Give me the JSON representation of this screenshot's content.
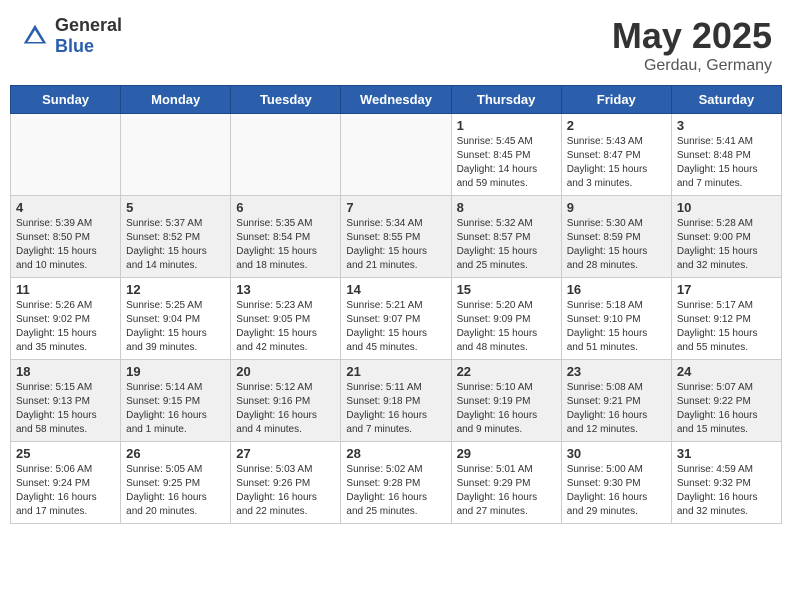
{
  "header": {
    "logo": {
      "general": "General",
      "blue": "Blue"
    },
    "title": "May 2025",
    "location": "Gerdau, Germany"
  },
  "calendar": {
    "days_of_week": [
      "Sunday",
      "Monday",
      "Tuesday",
      "Wednesday",
      "Thursday",
      "Friday",
      "Saturday"
    ],
    "weeks": [
      [
        {
          "day": "",
          "empty": true
        },
        {
          "day": "",
          "empty": true
        },
        {
          "day": "",
          "empty": true
        },
        {
          "day": "",
          "empty": true
        },
        {
          "day": "1",
          "lines": [
            "Sunrise: 5:45 AM",
            "Sunset: 8:45 PM",
            "Daylight: 14 hours",
            "and 59 minutes."
          ]
        },
        {
          "day": "2",
          "lines": [
            "Sunrise: 5:43 AM",
            "Sunset: 8:47 PM",
            "Daylight: 15 hours",
            "and 3 minutes."
          ]
        },
        {
          "day": "3",
          "lines": [
            "Sunrise: 5:41 AM",
            "Sunset: 8:48 PM",
            "Daylight: 15 hours",
            "and 7 minutes."
          ]
        }
      ],
      [
        {
          "day": "4",
          "lines": [
            "Sunrise: 5:39 AM",
            "Sunset: 8:50 PM",
            "Daylight: 15 hours",
            "and 10 minutes."
          ]
        },
        {
          "day": "5",
          "lines": [
            "Sunrise: 5:37 AM",
            "Sunset: 8:52 PM",
            "Daylight: 15 hours",
            "and 14 minutes."
          ]
        },
        {
          "day": "6",
          "lines": [
            "Sunrise: 5:35 AM",
            "Sunset: 8:54 PM",
            "Daylight: 15 hours",
            "and 18 minutes."
          ]
        },
        {
          "day": "7",
          "lines": [
            "Sunrise: 5:34 AM",
            "Sunset: 8:55 PM",
            "Daylight: 15 hours",
            "and 21 minutes."
          ]
        },
        {
          "day": "8",
          "lines": [
            "Sunrise: 5:32 AM",
            "Sunset: 8:57 PM",
            "Daylight: 15 hours",
            "and 25 minutes."
          ]
        },
        {
          "day": "9",
          "lines": [
            "Sunrise: 5:30 AM",
            "Sunset: 8:59 PM",
            "Daylight: 15 hours",
            "and 28 minutes."
          ]
        },
        {
          "day": "10",
          "lines": [
            "Sunrise: 5:28 AM",
            "Sunset: 9:00 PM",
            "Daylight: 15 hours",
            "and 32 minutes."
          ]
        }
      ],
      [
        {
          "day": "11",
          "lines": [
            "Sunrise: 5:26 AM",
            "Sunset: 9:02 PM",
            "Daylight: 15 hours",
            "and 35 minutes."
          ]
        },
        {
          "day": "12",
          "lines": [
            "Sunrise: 5:25 AM",
            "Sunset: 9:04 PM",
            "Daylight: 15 hours",
            "and 39 minutes."
          ]
        },
        {
          "day": "13",
          "lines": [
            "Sunrise: 5:23 AM",
            "Sunset: 9:05 PM",
            "Daylight: 15 hours",
            "and 42 minutes."
          ]
        },
        {
          "day": "14",
          "lines": [
            "Sunrise: 5:21 AM",
            "Sunset: 9:07 PM",
            "Daylight: 15 hours",
            "and 45 minutes."
          ]
        },
        {
          "day": "15",
          "lines": [
            "Sunrise: 5:20 AM",
            "Sunset: 9:09 PM",
            "Daylight: 15 hours",
            "and 48 minutes."
          ]
        },
        {
          "day": "16",
          "lines": [
            "Sunrise: 5:18 AM",
            "Sunset: 9:10 PM",
            "Daylight: 15 hours",
            "and 51 minutes."
          ]
        },
        {
          "day": "17",
          "lines": [
            "Sunrise: 5:17 AM",
            "Sunset: 9:12 PM",
            "Daylight: 15 hours",
            "and 55 minutes."
          ]
        }
      ],
      [
        {
          "day": "18",
          "lines": [
            "Sunrise: 5:15 AM",
            "Sunset: 9:13 PM",
            "Daylight: 15 hours",
            "and 58 minutes."
          ]
        },
        {
          "day": "19",
          "lines": [
            "Sunrise: 5:14 AM",
            "Sunset: 9:15 PM",
            "Daylight: 16 hours",
            "and 1 minute."
          ]
        },
        {
          "day": "20",
          "lines": [
            "Sunrise: 5:12 AM",
            "Sunset: 9:16 PM",
            "Daylight: 16 hours",
            "and 4 minutes."
          ]
        },
        {
          "day": "21",
          "lines": [
            "Sunrise: 5:11 AM",
            "Sunset: 9:18 PM",
            "Daylight: 16 hours",
            "and 7 minutes."
          ]
        },
        {
          "day": "22",
          "lines": [
            "Sunrise: 5:10 AM",
            "Sunset: 9:19 PM",
            "Daylight: 16 hours",
            "and 9 minutes."
          ]
        },
        {
          "day": "23",
          "lines": [
            "Sunrise: 5:08 AM",
            "Sunset: 9:21 PM",
            "Daylight: 16 hours",
            "and 12 minutes."
          ]
        },
        {
          "day": "24",
          "lines": [
            "Sunrise: 5:07 AM",
            "Sunset: 9:22 PM",
            "Daylight: 16 hours",
            "and 15 minutes."
          ]
        }
      ],
      [
        {
          "day": "25",
          "lines": [
            "Sunrise: 5:06 AM",
            "Sunset: 9:24 PM",
            "Daylight: 16 hours",
            "and 17 minutes."
          ]
        },
        {
          "day": "26",
          "lines": [
            "Sunrise: 5:05 AM",
            "Sunset: 9:25 PM",
            "Daylight: 16 hours",
            "and 20 minutes."
          ]
        },
        {
          "day": "27",
          "lines": [
            "Sunrise: 5:03 AM",
            "Sunset: 9:26 PM",
            "Daylight: 16 hours",
            "and 22 minutes."
          ]
        },
        {
          "day": "28",
          "lines": [
            "Sunrise: 5:02 AM",
            "Sunset: 9:28 PM",
            "Daylight: 16 hours",
            "and 25 minutes."
          ]
        },
        {
          "day": "29",
          "lines": [
            "Sunrise: 5:01 AM",
            "Sunset: 9:29 PM",
            "Daylight: 16 hours",
            "and 27 minutes."
          ]
        },
        {
          "day": "30",
          "lines": [
            "Sunrise: 5:00 AM",
            "Sunset: 9:30 PM",
            "Daylight: 16 hours",
            "and 29 minutes."
          ]
        },
        {
          "day": "31",
          "lines": [
            "Sunrise: 4:59 AM",
            "Sunset: 9:32 PM",
            "Daylight: 16 hours",
            "and 32 minutes."
          ]
        }
      ]
    ]
  }
}
